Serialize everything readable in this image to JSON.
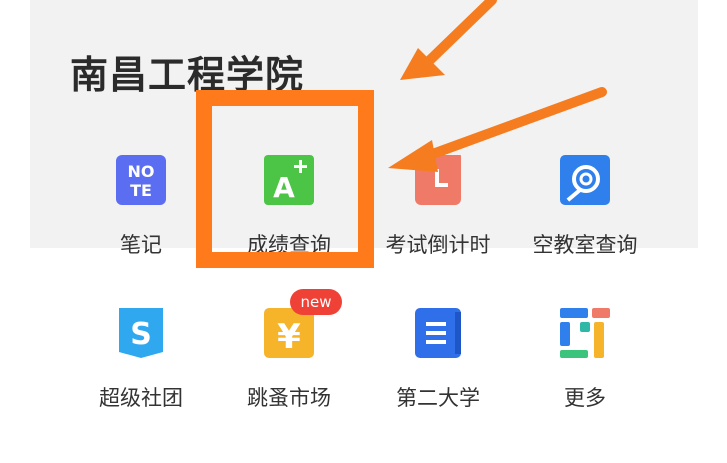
{
  "school_name": "南昌工程学院",
  "tiles": [
    {
      "label": "笔记",
      "icon": "note-icon",
      "color": "#5b6ef2"
    },
    {
      "label": "成绩查询",
      "icon": "grade-a-plus-icon",
      "color": "#4cc445"
    },
    {
      "label": "考试倒计时",
      "icon": "clock-icon",
      "color": "#f07a68"
    },
    {
      "label": "空教室查询",
      "icon": "search-room-icon",
      "color": "#2f80ed"
    },
    {
      "label": "超级社团",
      "icon": "s-club-icon",
      "color": "#2fa8f0"
    },
    {
      "label": "跳蚤市场",
      "icon": "yen-icon",
      "color": "#f5b42a"
    },
    {
      "label": "第二大学",
      "icon": "book-icon",
      "color": "#2f6fea"
    },
    {
      "label": "更多",
      "icon": "more-blocks-icon",
      "color": "#e25a45"
    }
  ],
  "badge_new": "new",
  "annotation": {
    "frame_color": "#ff7a1a",
    "arrow_color": "#f57c1f"
  }
}
